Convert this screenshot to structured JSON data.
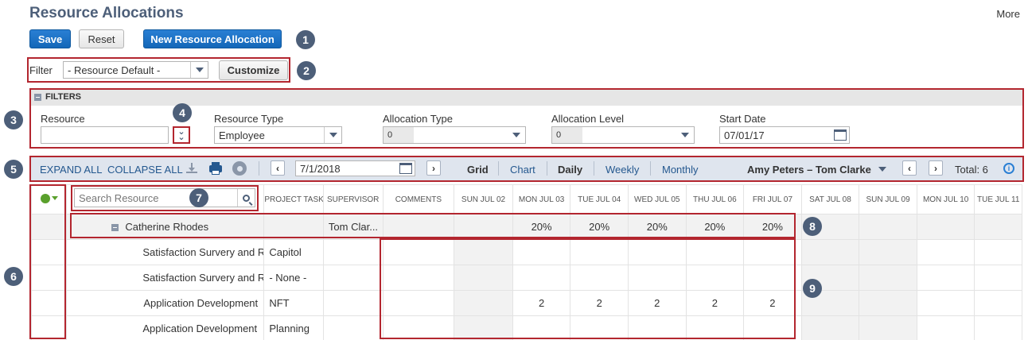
{
  "page": {
    "title": "Resource Allocations",
    "more": "More"
  },
  "actions": {
    "save": "Save",
    "reset": "Reset",
    "new": "New Resource Allocation"
  },
  "filter_bar": {
    "label": "Filter",
    "value": "- Resource Default -",
    "customize": "Customize"
  },
  "filters": {
    "header": "FILTERS",
    "resource": {
      "label": "Resource",
      "value": ""
    },
    "resource_type": {
      "label": "Resource Type",
      "value": "Employee"
    },
    "allocation_type": {
      "label": "Allocation Type",
      "value": "0"
    },
    "allocation_level": {
      "label": "Allocation Level",
      "value": "0"
    },
    "start_date": {
      "label": "Start Date",
      "value": "07/01/17"
    }
  },
  "toolbar": {
    "expand_all": "EXPAND ALL",
    "collapse_all": "COLLAPSE ALL",
    "date": "7/1/2018",
    "grid": "Grid",
    "chart": "Chart",
    "daily": "Daily",
    "weekly": "Weekly",
    "monthly": "Monthly",
    "range": "Amy Peters – Tom Clarke",
    "total": "Total: 6"
  },
  "table": {
    "search_placeholder": "Search Resource",
    "columns": [
      "PROJECT TASK",
      "SUPERVISOR",
      "COMMENTS",
      "SUN JUL 02",
      "MON JUL 03",
      "TUE JUL 04",
      "WED JUL 05",
      "THU JUL 06",
      "FRI JUL 07",
      "SAT JUL 08",
      "SUN JUL 09",
      "MON JUL 10",
      "TUE JUL 11"
    ],
    "group": {
      "name": "Catherine Rhodes",
      "supervisor": "Tom Clar...",
      "days": [
        "",
        "20%",
        "20%",
        "20%",
        "20%",
        "20%",
        "",
        "",
        "",
        ""
      ]
    },
    "rows": [
      {
        "name": "Satisfaction Survery and Report",
        "task": "Capitol",
        "days": [
          "",
          "",
          "",
          "",
          "",
          "",
          "",
          "",
          "",
          ""
        ]
      },
      {
        "name": "Satisfaction Survery and Report",
        "task": "- None -",
        "days": [
          "",
          "",
          "",
          "",
          "",
          "",
          "",
          "",
          "",
          ""
        ]
      },
      {
        "name": "Application Development",
        "task": "NFT",
        "days": [
          "",
          "2",
          "2",
          "2",
          "2",
          "2",
          "",
          "",
          "",
          ""
        ]
      },
      {
        "name": "Application Development",
        "task": "Planning",
        "days": [
          "",
          "",
          "",
          "",
          "",
          "",
          "",
          "",
          "",
          ""
        ]
      }
    ]
  },
  "callouts": [
    "1",
    "2",
    "3",
    "4",
    "5",
    "6",
    "7",
    "8",
    "9"
  ],
  "colors": {
    "primary": "#1467b8",
    "callout": "#4d5f79",
    "highlight": "#b3262f",
    "toolbar": "#dfe5ee"
  }
}
